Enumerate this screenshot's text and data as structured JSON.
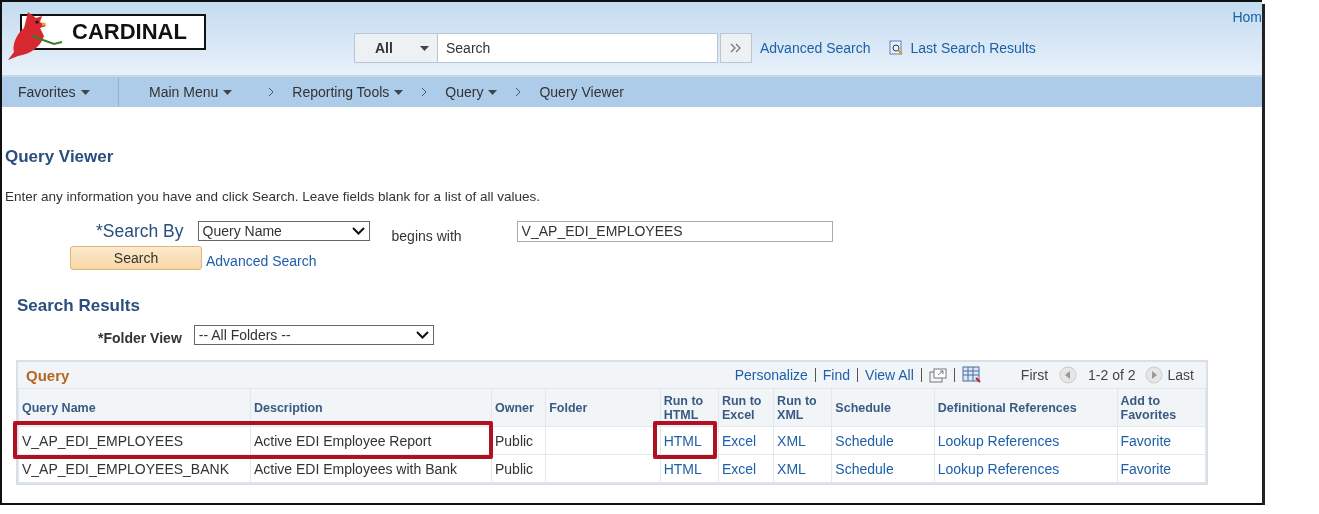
{
  "header": {
    "logo_text": "CARDINAL",
    "home_link": "Hom",
    "search_scope": "All",
    "search_placeholder": "Search",
    "advanced_search": "Advanced Search",
    "last_search_results": "Last Search Results"
  },
  "nav": {
    "favorites": "Favorites",
    "main_menu": "Main Menu",
    "breadcrumbs": [
      {
        "label": "Reporting Tools",
        "menu": true
      },
      {
        "label": "Query",
        "menu": true
      },
      {
        "label": "Query Viewer",
        "menu": false
      }
    ]
  },
  "page": {
    "title": "Query Viewer",
    "instructions": "Enter any information you have and click Search. Leave fields blank for a list of all values.",
    "search_by_label": "*Search By",
    "search_by_value": "Query Name",
    "operator": "begins with",
    "search_value": "V_AP_EDI_EMPLOYEES",
    "search_button": "Search",
    "advanced_search": "Advanced Search",
    "results_title": "Search Results",
    "folder_view_label": "*Folder View",
    "folder_view_value": "-- All Folders --"
  },
  "grid": {
    "title": "Query",
    "toolbar": {
      "personalize": "Personalize",
      "find": "Find",
      "view_all": "View All",
      "first": "First",
      "range": "1-2 of 2",
      "last": "Last"
    },
    "columns": [
      "Query Name",
      "Description",
      "Owner",
      "Folder",
      "Run to HTML",
      "Run to Excel",
      "Run to XML",
      "Schedule",
      "Definitional References",
      "Add to Favorites"
    ],
    "rows": [
      {
        "query_name": "V_AP_EDI_EMPLOYEES",
        "description": "Active EDI Employee Report",
        "owner": "Public",
        "folder": "",
        "html": "HTML",
        "excel": "Excel",
        "xml": "XML",
        "schedule": "Schedule",
        "references": "Lookup References",
        "favorite": "Favorite",
        "name_highlighted": true,
        "html_highlighted": true
      },
      {
        "query_name": "V_AP_EDI_EMPLOYEES_BANK",
        "description": "Active EDI Employees with Bank",
        "owner": "Public",
        "folder": "",
        "html": "HTML",
        "excel": "Excel",
        "xml": "XML",
        "schedule": "Schedule",
        "references": "Lookup References",
        "favorite": "Favorite",
        "name_highlighted": false,
        "html_highlighted": false
      }
    ]
  }
}
